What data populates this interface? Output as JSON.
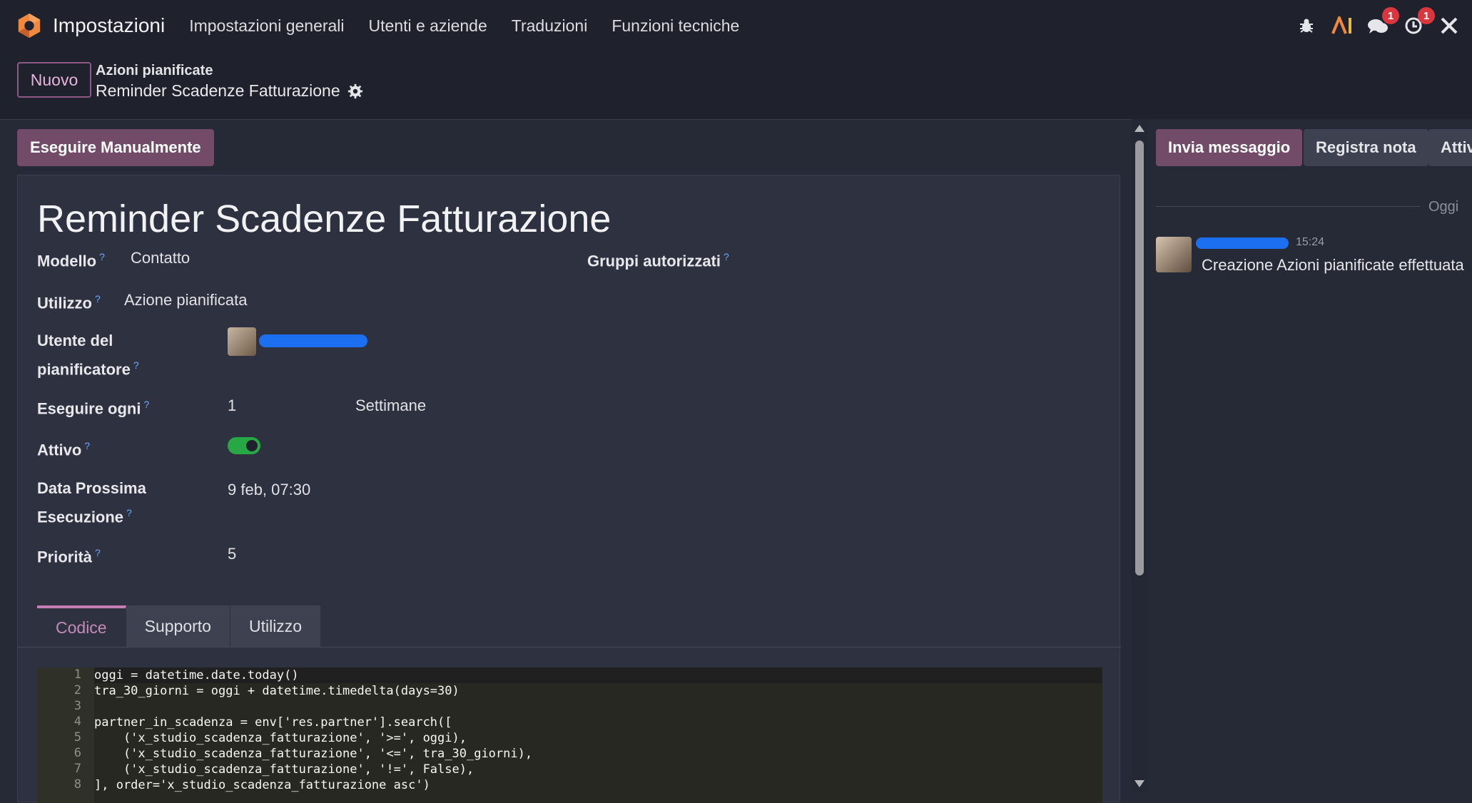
{
  "colors": {
    "accent": "#714b67",
    "toggle_on": "#27a844",
    "help": "#6ea8ff",
    "badge": "#d9363e"
  },
  "navbar": {
    "app_title": "Impostazioni",
    "menu": [
      "Impostazioni generali",
      "Utenti e aziende",
      "Traduzioni",
      "Funzioni tecniche"
    ],
    "icons": [
      "bug-icon",
      "ai-icon",
      "messages-icon",
      "activity-clock-icon",
      "tools-icon"
    ],
    "messages_badge": "1",
    "activity_badge": "1"
  },
  "control": {
    "new_button": "Nuovo",
    "breadcrumb_parent": "Azioni pianificate",
    "breadcrumb_current": "Reminder Scadenze Fatturazione"
  },
  "main": {
    "run_manually": "Eseguire Manualmente",
    "record_title": "Reminder Scadenze Fatturazione",
    "help_marker": "?",
    "fields": {
      "model_label": "Modello",
      "model_value": "Contatto",
      "groups_label": "Gruppi autorizzati",
      "usage_label": "Utilizzo",
      "usage_value": "Azione pianificata",
      "user_label_1": "Utente del",
      "user_label_2": "pianificatore",
      "interval_label": "Eseguire ogni",
      "interval_number": "1",
      "interval_type": "Settimane",
      "active_label": "Attivo",
      "active_value": true,
      "nextcall_label_1": "Data Prossima",
      "nextcall_label_2": "Esecuzione",
      "nextcall_value": "9 feb, 07:30",
      "priority_label": "Priorità",
      "priority_value": "5"
    },
    "tabs": [
      "Codice",
      "Supporto",
      "Utilizzo"
    ],
    "code_line_numbers": [
      "1",
      "2",
      "3",
      "4",
      "5",
      "6",
      "7",
      "8"
    ],
    "code_lines": [
      "oggi = datetime.date.today()",
      "tra_30_giorni = oggi + datetime.timedelta(days=30)",
      "",
      "partner_in_scadenza = env['res.partner'].search([",
      "    ('x_studio_scadenza_fatturazione', '>=', oggi),",
      "    ('x_studio_scadenza_fatturazione', '<=', tra_30_giorni),",
      "    ('x_studio_scadenza_fatturazione', '!=', False),",
      "], order='x_studio_scadenza_fatturazione asc')"
    ]
  },
  "chatter": {
    "send_message": "Invia messaggio",
    "log_note": "Registra nota",
    "activities": "Attiv",
    "date_separator": "Oggi",
    "message_time": "15:24",
    "message_body": "Creazione Azioni pianificate effettuata"
  }
}
